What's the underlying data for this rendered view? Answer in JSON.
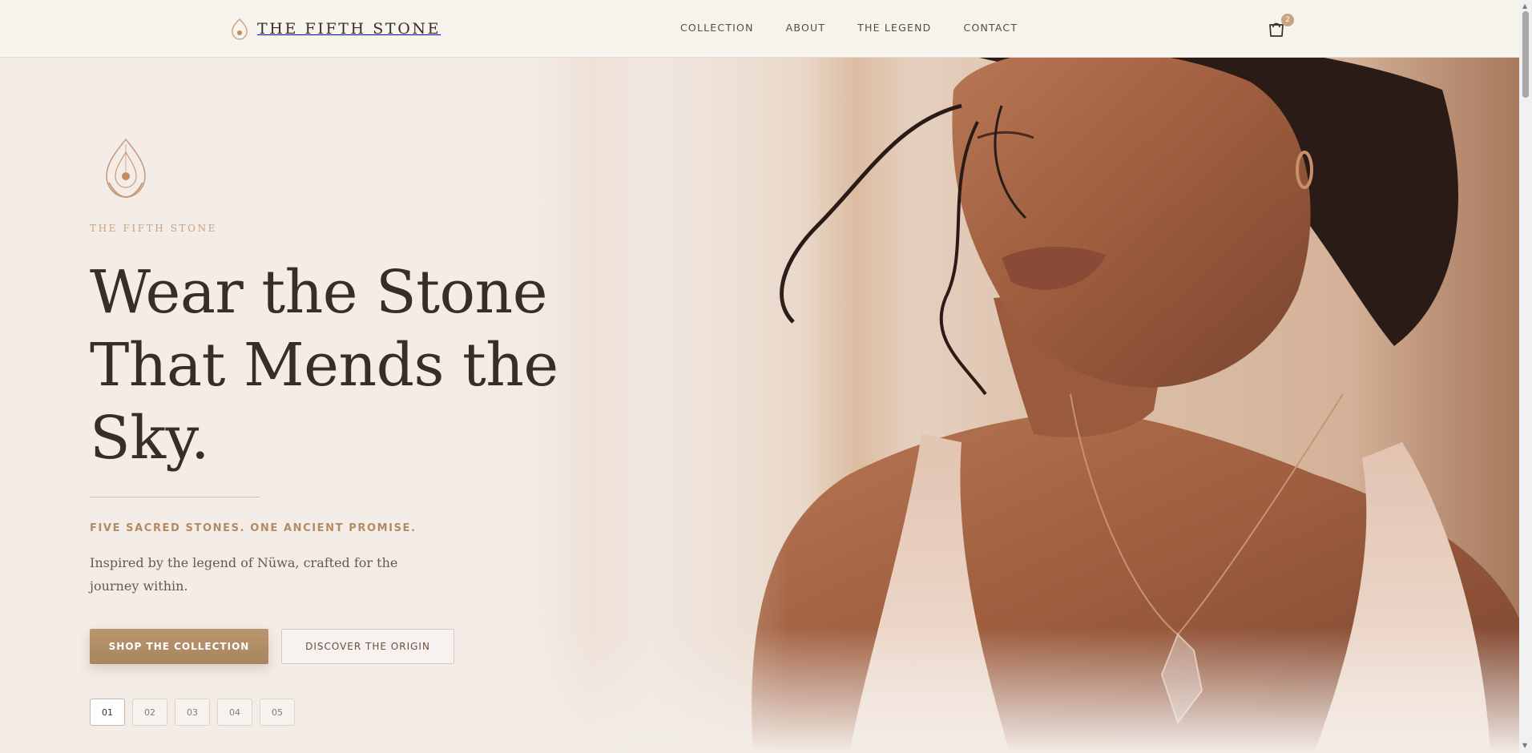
{
  "header": {
    "logo_text": "THE FIFTH STONE",
    "nav": [
      "COLLECTION",
      "ABOUT",
      "THE LEGEND",
      "CONTACT"
    ],
    "cart_count": "2"
  },
  "hero": {
    "eyebrow": "THE FIFTH STONE",
    "headline": "Wear the Stone That Mends the Sky.",
    "tagline": "FIVE SACRED STONES. ONE ANCIENT PROMISE.",
    "description": "Inspired by the legend of Nüwa, crafted for the journey within.",
    "primary_cta": "SHOP THE COLLECTION",
    "secondary_cta": "DISCOVER THE ORIGIN",
    "pagination": [
      "01",
      "02",
      "03",
      "04",
      "05"
    ],
    "active_page": "01"
  },
  "icons": {
    "logo": "stone-pendant-icon",
    "cart": "shopping-bag-icon",
    "hero_emblem": "stone-emblem-icon"
  },
  "colors": {
    "accent": "#b48a63",
    "button": "#b08d66",
    "text": "#3a2c26",
    "background": "#f3ece6"
  }
}
